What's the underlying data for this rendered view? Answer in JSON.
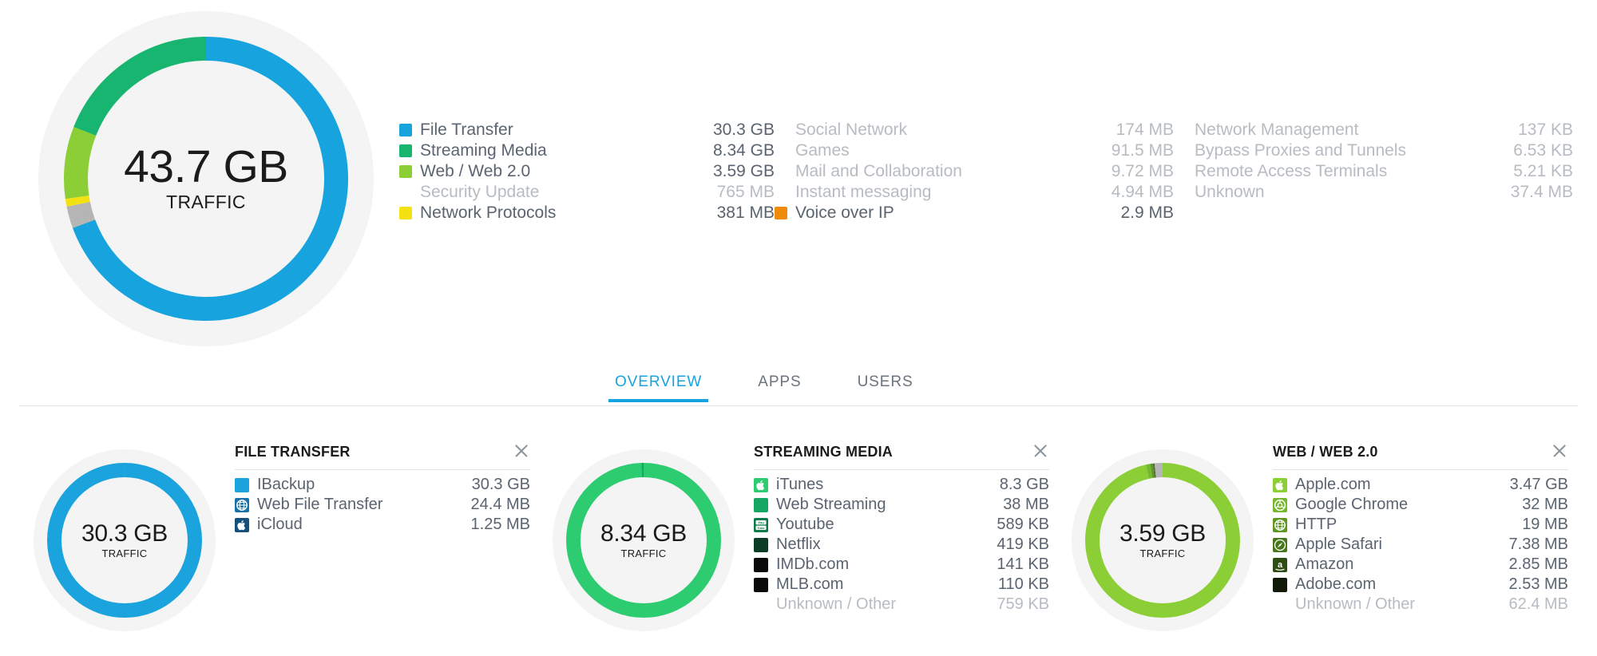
{
  "colors": {
    "file_transfer": "#17a3dd",
    "streaming_media": "#17b56f",
    "web": "#8cce36",
    "security_update": "#b5b5b5",
    "network_protocols": "#f4e112",
    "voice_over_ip": "#ee8b0b",
    "unknown": "#b5b5b5",
    "accent": "#17a3dd",
    "text": "#5a6470",
    "text_dim": "#b7bcc2"
  },
  "main_donut": {
    "value": "43.7 GB",
    "label": "TRAFFIC"
  },
  "legend": {
    "columns": [
      {
        "rows": [
          {
            "label": "File Transfer",
            "value": "30.3 GB",
            "color": "#17a3dd",
            "dim": false
          },
          {
            "label": "Streaming Media",
            "value": "8.34 GB",
            "color": "#17b56f",
            "dim": false
          },
          {
            "label": "Web / Web 2.0",
            "value": "3.59 GB",
            "color": "#8cce36",
            "dim": false
          },
          {
            "label": "Security Update",
            "value": "765 MB",
            "color": null,
            "dim": true
          },
          {
            "label": "Network Protocols",
            "value": "381 MB",
            "color": "#f4e112",
            "dim": false
          }
        ]
      },
      {
        "rows": [
          {
            "label": "Social Network",
            "value": "174 MB",
            "color": null,
            "dim": true
          },
          {
            "label": "Games",
            "value": "91.5 MB",
            "color": null,
            "dim": true
          },
          {
            "label": "Mail and Collaboration",
            "value": "9.72 MB",
            "color": null,
            "dim": true
          },
          {
            "label": "Instant messaging",
            "value": "4.94 MB",
            "color": null,
            "dim": true
          },
          {
            "label": "Voice over IP",
            "value": "2.9 MB",
            "color": "#ee8b0b",
            "dim": false
          }
        ]
      },
      {
        "rows": [
          {
            "label": "Network Management",
            "value": "137 KB",
            "color": null,
            "dim": true
          },
          {
            "label": "Bypass Proxies and Tunnels",
            "value": "6.53 KB",
            "color": null,
            "dim": true
          },
          {
            "label": "Remote Access Terminals",
            "value": "5.21 KB",
            "color": null,
            "dim": true
          },
          {
            "label": "Unknown",
            "value": "37.4 MB",
            "color": null,
            "dim": true
          }
        ]
      }
    ]
  },
  "tabs": [
    {
      "label": "OVERVIEW",
      "active": true
    },
    {
      "label": "APPS",
      "active": false
    },
    {
      "label": "USERS",
      "active": false
    }
  ],
  "cards": [
    {
      "title": "FILE TRANSFER",
      "donut": {
        "value": "30.3 GB",
        "label": "TRAFFIC"
      },
      "apps": [
        {
          "name": "IBackup",
          "value": "30.3 GB",
          "color": "#1aa3dd",
          "icon": "square",
          "dim": false
        },
        {
          "name": "Web File Transfer",
          "value": "24.4 MB",
          "color": "#1a72a8",
          "icon": "globe",
          "dim": false
        },
        {
          "name": "iCloud",
          "value": "1.25 MB",
          "color": "#14527d",
          "icon": "apple",
          "dim": false
        }
      ]
    },
    {
      "title": "STREAMING MEDIA",
      "donut": {
        "value": "8.34 GB",
        "label": "TRAFFIC"
      },
      "apps": [
        {
          "name": "iTunes",
          "value": "8.3 GB",
          "color": "#2ecc71",
          "icon": "apple",
          "dim": false
        },
        {
          "name": "Web Streaming",
          "value": "38 MB",
          "color": "#16a765",
          "icon": "square",
          "dim": false
        },
        {
          "name": "Youtube",
          "value": "589 KB",
          "color": "#0e7a4a",
          "icon": "youtube",
          "dim": false
        },
        {
          "name": "Netflix",
          "value": "419 KB",
          "color": "#0b3d26",
          "icon": "square",
          "dim": false
        },
        {
          "name": "IMDb.com",
          "value": "141 KB",
          "color": "#0a0a0a",
          "icon": "square",
          "dim": false
        },
        {
          "name": "MLB.com",
          "value": "110 KB",
          "color": "#0a0a0a",
          "icon": "square",
          "dim": false
        },
        {
          "name": "Unknown / Other",
          "value": "759 KB",
          "color": null,
          "icon": "none",
          "dim": true
        }
      ]
    },
    {
      "title": "WEB / WEB 2.0",
      "donut": {
        "value": "3.59 GB",
        "label": "TRAFFIC"
      },
      "apps": [
        {
          "name": "Apple.com",
          "value": "3.47 GB",
          "color": "#8cce36",
          "icon": "apple",
          "dim": false
        },
        {
          "name": "Google Chrome",
          "value": "32 MB",
          "color": "#76b82c",
          "icon": "chrome",
          "dim": false
        },
        {
          "name": "HTTP",
          "value": "19 MB",
          "color": "#5f9624",
          "icon": "globe",
          "dim": false
        },
        {
          "name": "Apple Safari",
          "value": "7.38 MB",
          "color": "#4a761c",
          "icon": "safari",
          "dim": false
        },
        {
          "name": "Amazon",
          "value": "2.85 MB",
          "color": "#2f4d12",
          "icon": "amazon",
          "dim": false
        },
        {
          "name": "Adobe.com",
          "value": "2.53 MB",
          "color": "#111a08",
          "icon": "square",
          "dim": false
        },
        {
          "name": "Unknown / Other",
          "value": "62.4 MB",
          "color": null,
          "icon": "none",
          "dim": true
        }
      ]
    }
  ],
  "chart_data": [
    {
      "type": "pie",
      "title": "43.7 GB TRAFFIC",
      "legend_position": "right",
      "categories": [
        "File Transfer",
        "Streaming Media",
        "Web / Web 2.0",
        "Security Update",
        "Network Protocols",
        "Social Network",
        "Games",
        "Mail and Collaboration",
        "Instant messaging",
        "Voice over IP",
        "Network Management",
        "Bypass Proxies and Tunnels",
        "Remote Access Terminals",
        "Unknown"
      ],
      "values_text": [
        "30.3 GB",
        "8.34 GB",
        "3.59 GB",
        "765 MB",
        "381 MB",
        "174 MB",
        "91.5 MB",
        "9.72 MB",
        "4.94 MB",
        "2.9 MB",
        "137 KB",
        "6.53 KB",
        "5.21 KB",
        "37.4 MB"
      ],
      "values_gb": [
        30.3,
        8.34,
        3.59,
        0.765,
        0.381,
        0.174,
        0.0915,
        0.00972,
        0.00494,
        0.0029,
        0.000137,
        6.5e-06,
        5.2e-06,
        0.0374
      ],
      "total": "43.7 GB",
      "colors": [
        "#17a3dd",
        "#17b56f",
        "#8cce36",
        "#b5b5b5",
        "#f4e112",
        "#b5b5b5",
        "#b5b5b5",
        "#b5b5b5",
        "#b5b5b5",
        "#ee8b0b",
        "#b5b5b5",
        "#b5b5b5",
        "#b5b5b5",
        "#b5b5b5"
      ]
    },
    {
      "type": "pie",
      "title": "30.3 GB TRAFFIC",
      "categories": [
        "IBackup",
        "Web File Transfer",
        "iCloud"
      ],
      "values_text": [
        "30.3 GB",
        "24.4 MB",
        "1.25 MB"
      ],
      "values_gb": [
        30.3,
        0.0244,
        0.00125
      ],
      "total": "30.3 GB",
      "colors": [
        "#1aa3dd",
        "#1a72a8",
        "#14527d"
      ]
    },
    {
      "type": "pie",
      "title": "8.34 GB TRAFFIC",
      "categories": [
        "iTunes",
        "Web Streaming",
        "Youtube",
        "Netflix",
        "IMDb.com",
        "MLB.com",
        "Unknown / Other"
      ],
      "values_text": [
        "8.3 GB",
        "38 MB",
        "589 KB",
        "419 KB",
        "141 KB",
        "110 KB",
        "759 KB"
      ],
      "values_gb": [
        8.3,
        0.038,
        0.000589,
        0.000419,
        0.000141,
        0.00011,
        0.000759
      ],
      "total": "8.34 GB",
      "colors": [
        "#2ecc71",
        "#16a765",
        "#0e7a4a",
        "#0b3d26",
        "#0a0a0a",
        "#0a0a0a",
        "#b5b5b5"
      ]
    },
    {
      "type": "pie",
      "title": "3.59 GB TRAFFIC",
      "categories": [
        "Apple.com",
        "Google Chrome",
        "HTTP",
        "Apple Safari",
        "Amazon",
        "Adobe.com",
        "Unknown / Other"
      ],
      "values_text": [
        "3.47 GB",
        "32 MB",
        "19 MB",
        "7.38 MB",
        "2.85 MB",
        "2.53 MB",
        "62.4 MB"
      ],
      "values_gb": [
        3.47,
        0.032,
        0.019,
        0.00738,
        0.00285,
        0.00253,
        0.0624
      ],
      "total": "3.59 GB",
      "colors": [
        "#8cce36",
        "#76b82c",
        "#5f9624",
        "#4a761c",
        "#2f4d12",
        "#111a08",
        "#b5b5b5"
      ]
    }
  ]
}
